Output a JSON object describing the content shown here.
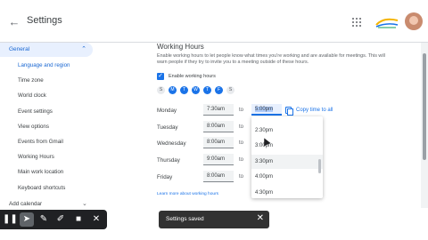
{
  "header": {
    "title": "Settings",
    "back_icon": "arrow-left-icon",
    "apps_icon": "apps-grid-icon",
    "avatar_icon": "user-avatar"
  },
  "sidebar": {
    "group": "General",
    "items": [
      "Language and region",
      "Time zone",
      "World clock",
      "Event settings",
      "View options",
      "Events from Gmail",
      "Working Hours",
      "Main work location",
      "Keyboard shortcuts"
    ],
    "active": "Language and region",
    "add_calendar": "Add calendar"
  },
  "working_hours": {
    "title": "Working Hours",
    "description": "Enable working hours to let people know what times you're working and are available for meetings. This will warn people if they try to invite you to a meeting outside of these hours.",
    "enable_label": "Enable working hours",
    "enabled": true,
    "days": [
      {
        "letter": "S",
        "on": false
      },
      {
        "letter": "M",
        "on": true
      },
      {
        "letter": "T",
        "on": true
      },
      {
        "letter": "W",
        "on": true
      },
      {
        "letter": "T",
        "on": true
      },
      {
        "letter": "F",
        "on": true
      },
      {
        "letter": "S",
        "on": false
      }
    ],
    "to_label": "to",
    "rows": [
      {
        "day": "Monday",
        "start": "7:30am",
        "end": "5:00pm"
      },
      {
        "day": "Tuesday",
        "start": "8:00am",
        "end": ""
      },
      {
        "day": "Wednesday",
        "start": "8:00am",
        "end": ""
      },
      {
        "day": "Thursday",
        "start": "9:00am",
        "end": ""
      },
      {
        "day": "Friday",
        "start": "8:00am",
        "end": ""
      }
    ],
    "copy_label": "Copy time to all",
    "learn_more": "Learn more about working hours"
  },
  "dropdown": {
    "options": [
      "2:30pm",
      "3:00pm",
      "3:30pm",
      "4:00pm",
      "4:30pm"
    ],
    "highlighted": "3:30pm"
  },
  "snackbar": {
    "message": "Settings saved",
    "close_icon": "close-icon"
  },
  "toolbar": {
    "icons": [
      "pause-icon",
      "cursor-icon",
      "pen-icon",
      "highlighter-icon",
      "camera-icon",
      "close-icon"
    ]
  },
  "colors": {
    "accent": "#1a73e8",
    "selected_bg": "#e8f0fe",
    "snackbar": "#323232",
    "toolbar": "#202124"
  }
}
